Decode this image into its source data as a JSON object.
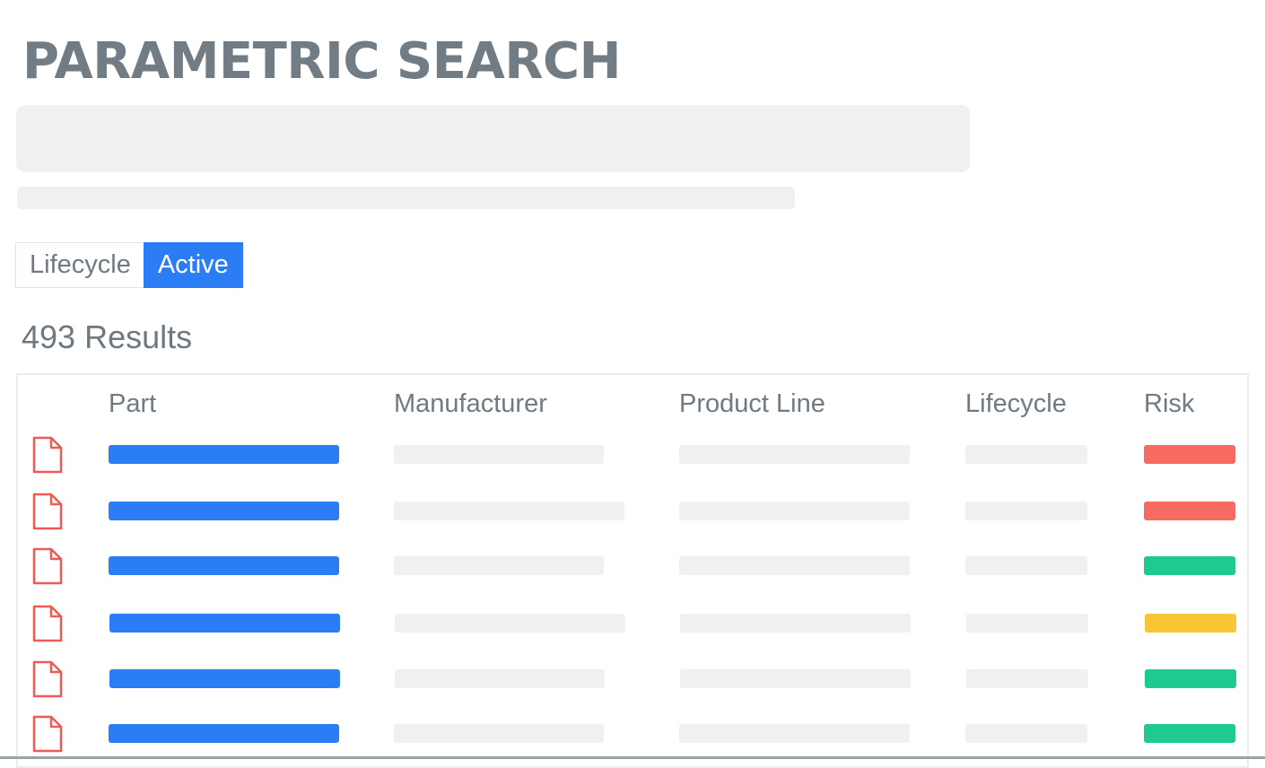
{
  "header": {
    "title": "PARAMETRIC SEARCH"
  },
  "filter": {
    "label": "Lifecycle",
    "value": "Active"
  },
  "results": {
    "count_text": "493 Results"
  },
  "table": {
    "columns": [
      "Part",
      "Manufacturer",
      "Product Line",
      "Lifecycle",
      "Risk"
    ],
    "rows": [
      {
        "risk": "high"
      },
      {
        "risk": "high"
      },
      {
        "risk": "low"
      },
      {
        "risk": "medium"
      },
      {
        "risk": "low"
      },
      {
        "risk": "low"
      }
    ]
  },
  "colors": {
    "accent": "#2a7df5",
    "risk_high": "#f66a62",
    "risk_medium": "#f8c633",
    "risk_low": "#1fca8e",
    "document_icon": "#f05a55",
    "placeholder": "#f0f0f0"
  },
  "icons": {
    "row": "document-icon"
  }
}
